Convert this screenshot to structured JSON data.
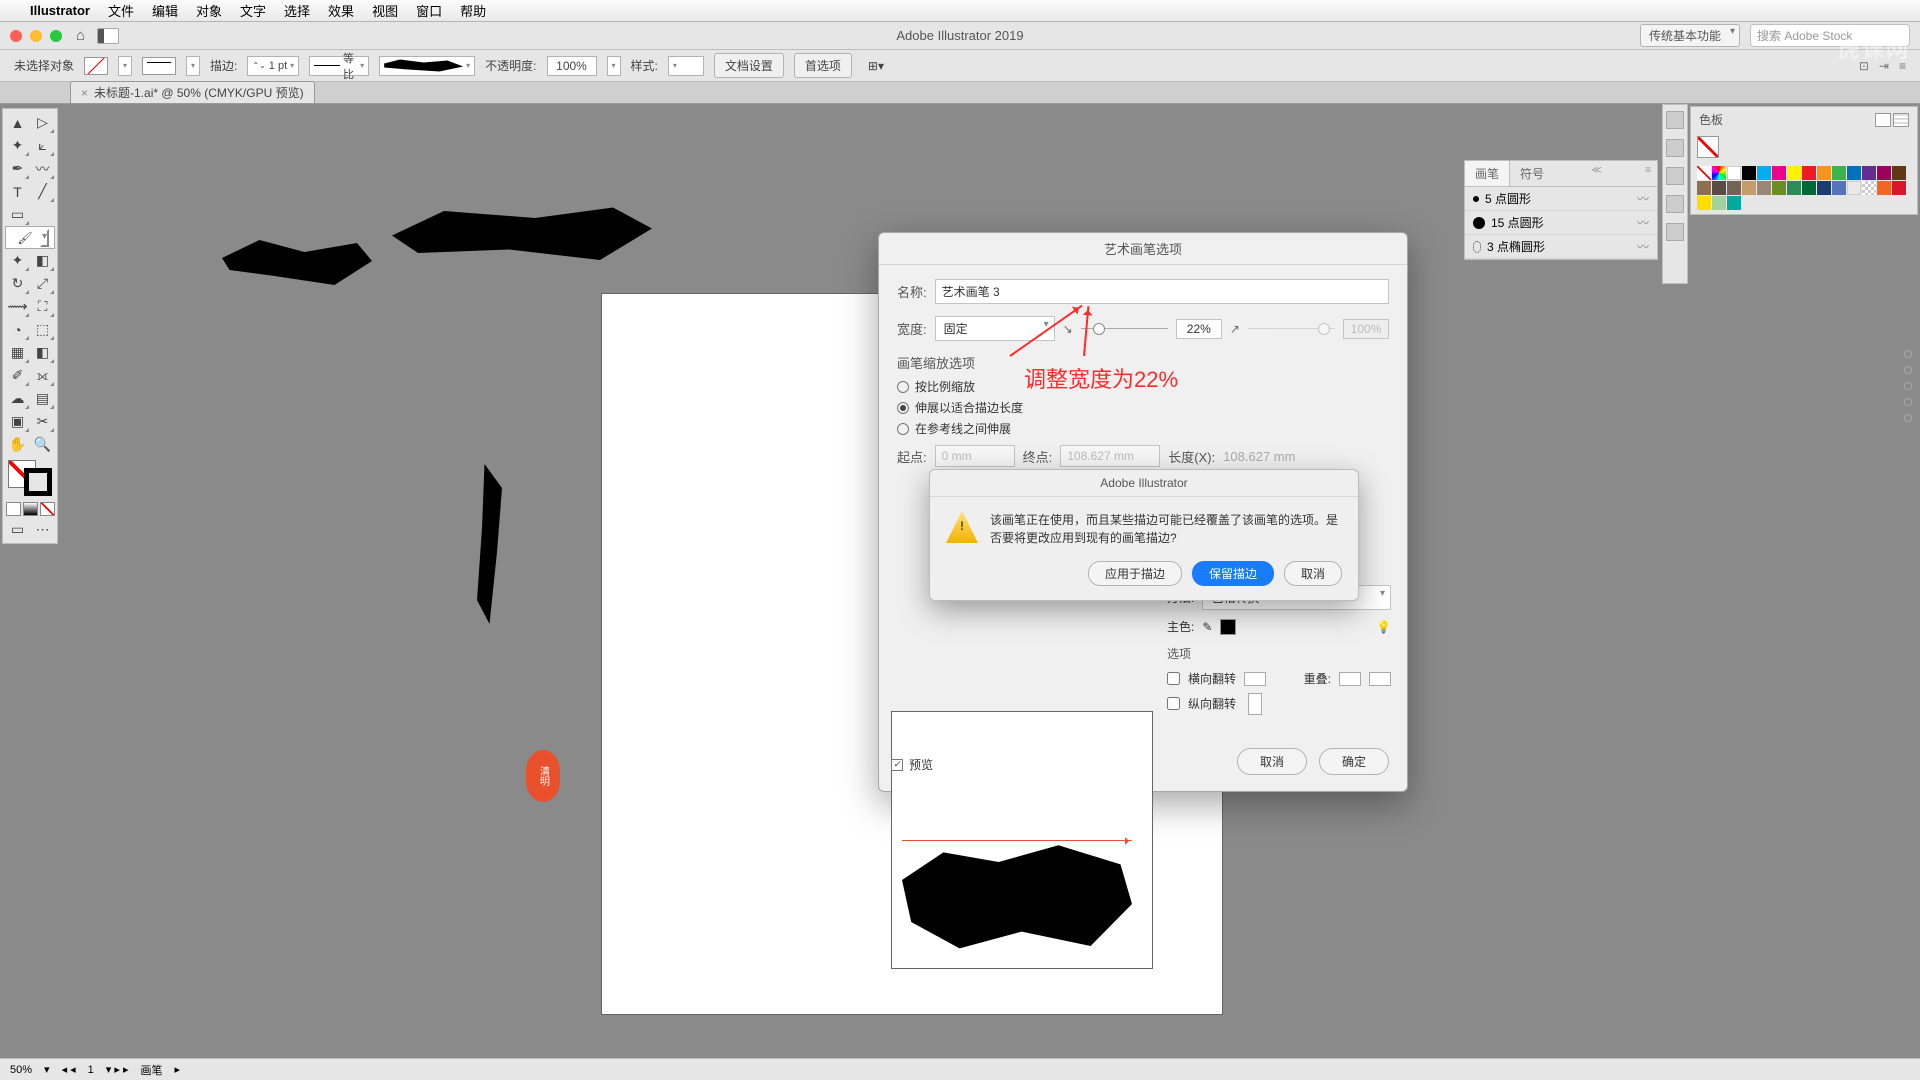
{
  "menu": {
    "apple": "",
    "app": "Illustrator",
    "items": [
      "文件",
      "编辑",
      "对象",
      "文字",
      "选择",
      "效果",
      "视图",
      "窗口",
      "帮助"
    ]
  },
  "window": {
    "title": "Adobe Illustrator 2019",
    "workspace": "传统基本功能",
    "searchPlaceholder": "搜索 Adobe Stock"
  },
  "control": {
    "selection": "未选择对象",
    "strokeLabel": "描边:",
    "strokeVal": "1 pt",
    "dash": "等比",
    "opacityLabel": "不透明度:",
    "opacityVal": "100%",
    "styleLabel": "样式:",
    "docSetup": "文档设置",
    "prefs": "首选项"
  },
  "doc": {
    "tab": "未标题-1.ai* @ 50% (CMYK/GPU 预览)"
  },
  "status": {
    "zoom": "50%",
    "art": "1",
    "artMode": "画笔"
  },
  "brushesPanel": {
    "t1": "画笔",
    "t2": "符号",
    "collapse": "≪",
    "items": [
      {
        "name": "5 点圆形"
      },
      {
        "name": "15 点圆形"
      },
      {
        "name": "3 点椭圆形"
      }
    ]
  },
  "swatches": {
    "title": "色板"
  },
  "dialog": {
    "title": "艺术画笔选项",
    "nameLabel": "名称:",
    "nameVal": "艺术画笔 3",
    "widthLabel": "宽度:",
    "widthMode": "固定",
    "widthVal": "22%",
    "widthMax": "100%",
    "scaleGroup": "画笔缩放选项",
    "r1": "按比例缩放",
    "r2": "伸展以适合描边长度",
    "r3": "在参考线之间伸展",
    "startLabel": "起点:",
    "startVal": "0 mm",
    "endLabel": "终点:",
    "endVal": "108.627 mm",
    "lenLabel": "长度(X):",
    "lenVal": "108.627 mm",
    "methodLabel": "方法:",
    "methodVal": "色相转换",
    "mainColorLabel": "主色:",
    "optionsLabel": "选项",
    "flipH": "横向翻转",
    "flipV": "纵向翻转",
    "overlapLabel": "重叠:",
    "preview": "预览",
    "cancel": "取消",
    "ok": "确定"
  },
  "alert": {
    "title": "Adobe Illustrator",
    "msg": "该画笔正在使用，而且某些描边可能已经覆盖了该画笔的选项。是否要将更改应用到现有的画笔描边?",
    "apply": "应用于描边",
    "keep": "保留描边",
    "cancel": "取消"
  },
  "anno": {
    "text": "调整宽度为22%"
  },
  "watermark": "虎课网"
}
